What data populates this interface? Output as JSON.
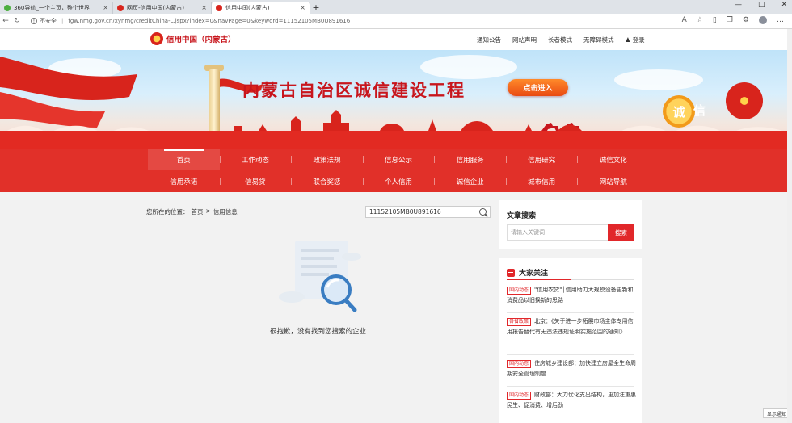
{
  "browser": {
    "tabs": [
      {
        "title": "360导航_一个主页，整个世界",
        "active": false,
        "icon_color": "#4caf3f"
      },
      {
        "title": "网页-信用中国(内蒙古)",
        "active": false,
        "icon_color": "#d8241c"
      },
      {
        "title": "信用中国(内蒙古)",
        "active": true,
        "icon_color": "#d8241c"
      }
    ],
    "new_tab": "+",
    "security_label": "不安全",
    "url": "fgw.nmg.gov.cn/xynmg/creditChina-L.jspx?index=0&navPage=0&keyword=11152105MB0U891616",
    "window_controls": [
      "—",
      "□",
      "✕"
    ]
  },
  "site": {
    "logo_text": "信用中国（内蒙古）",
    "top_links": [
      "通知公告",
      "网站声明",
      "长者模式",
      "无障碍模式",
      "登录"
    ]
  },
  "banner": {
    "title": "内蒙古自治区诚信建设工程",
    "enter_button": "点击进入",
    "badge_left": "诚",
    "badge_right": "信"
  },
  "nav": {
    "row1": [
      "首页",
      "工作动态",
      "政策法规",
      "信息公示",
      "信用服务",
      "信用研究",
      "诚信文化"
    ],
    "row2": [
      "信用承诺",
      "信易贷",
      "联合奖惩",
      "个人信用",
      "诚信企业",
      "城市信用",
      "网站导航"
    ],
    "current": "首页"
  },
  "content": {
    "breadcrumb_prefix": "您所在的位置：",
    "breadcrumb_home": "首页",
    "breadcrumb_sep": ">",
    "breadcrumb_current": "信用信息",
    "search_value": "11152105MB0U891616",
    "empty_message": "很抱歉，没有找到您搜索的企业"
  },
  "sidebar": {
    "article_search_title": "文章搜索",
    "keyword_placeholder": "请输入关键词",
    "search_button": "搜索",
    "focus_title": "大家关注",
    "news": [
      {
        "tag": "国内动态",
        "text": "\"信用农贷\"│信用助力大规模设备更新和消费品以旧换新的思路"
      },
      {
        "tag": "各省政策",
        "text": "北京：《关于进一步拓展市场主体专用信用报告替代有无违法违规证明实施范围的通知》"
      },
      {
        "tag": "国内动态",
        "text": "住房城乡建设部：加快建立房屋全生命周期安全管理制度"
      },
      {
        "tag": "国内动态",
        "text": "财政部：大力优化支出结构，更加注重惠民生、促消费、增后劲"
      }
    ]
  },
  "float_button": "显示通知",
  "colors": {
    "primary_red": "#e13029",
    "brand_red": "#c8161d",
    "button_orange": "#f0661c"
  }
}
